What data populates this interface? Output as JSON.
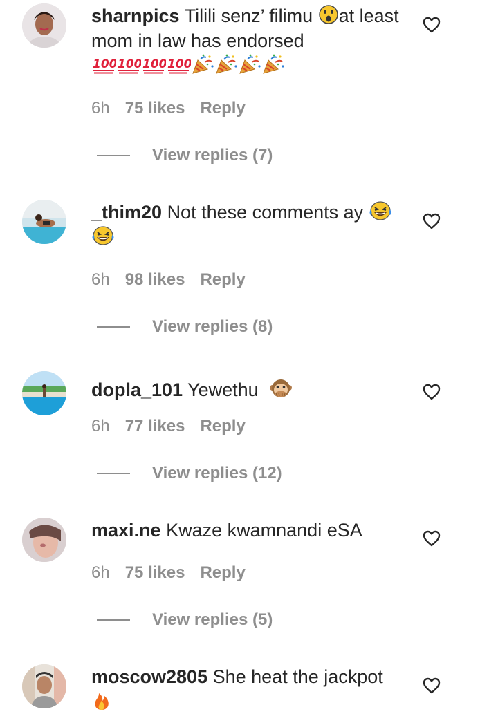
{
  "comments": [
    {
      "username": "sharnpics",
      "text_before": "Tilili senz’ filimu ",
      "text_after": "at least mom in law has endorsed",
      "emoji_line": "💯💯💯💯🎉🎉🎉🎉",
      "time": "6h",
      "likes": "75 likes",
      "reply": "Reply",
      "view_replies": "View replies (7)"
    },
    {
      "username": "_thim20",
      "text": "Not these comments ay",
      "emoji_line": "😂",
      "time": "6h",
      "likes": "98 likes",
      "reply": "Reply",
      "view_replies": "View replies (8)"
    },
    {
      "username": "dopla_101",
      "text": "Yewethu",
      "emoji": "🙊",
      "time": "6h",
      "likes": "77 likes",
      "reply": "Reply",
      "view_replies": "View replies (12)"
    },
    {
      "username": "maxi.ne",
      "text": "Kwaze kwamnandi eSA",
      "time": "6h",
      "likes": "75 likes",
      "reply": "Reply",
      "view_replies": "View replies (5)"
    },
    {
      "username": "moscow2805",
      "text": "She heat the jackpot",
      "emoji_line": "🔥"
    }
  ],
  "icons": {
    "like": "heart-outline-icon",
    "surprised": "face-open-mouth-emoji",
    "hundred": "hundred-points-emoji",
    "party": "party-popper-emoji",
    "laugh": "tears-of-joy-emoji",
    "monkey": "speak-no-evil-monkey-emoji",
    "fire": "fire-emoji"
  },
  "colors": {
    "text": "#262626",
    "secondary": "#8e8e8e",
    "background": "#ffffff"
  }
}
